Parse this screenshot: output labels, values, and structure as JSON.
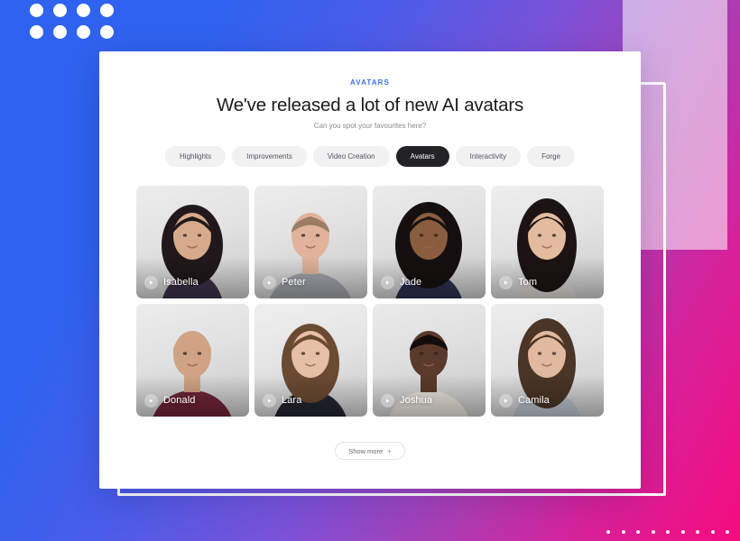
{
  "background": {
    "gradient_from": "#2f62ef",
    "gradient_mid": "#7b52d8",
    "gradient_to": "#f50c7e",
    "dot_color": "#ffffff",
    "dots_topleft_count": 8,
    "dots_bottomright_count": 10
  },
  "decor": {
    "glass_rect_label": "translucent-rectangle",
    "outline_frame_label": "white-outline-frame"
  },
  "panel": {
    "eyebrow": "AVATARS",
    "headline": "We've released a lot of new AI avatars",
    "subhead": "Can you spot your favourites here?",
    "accent_color": "#3d6fe6"
  },
  "tabs": [
    {
      "label": "Highlights",
      "active": false
    },
    {
      "label": "Improvements",
      "active": false
    },
    {
      "label": "Video Creation",
      "active": false
    },
    {
      "label": "Avatars",
      "active": true
    },
    {
      "label": "Interactivity",
      "active": false
    },
    {
      "label": "Forge",
      "active": false
    }
  ],
  "avatars": [
    {
      "name": "Isabella",
      "icon": "play-icon"
    },
    {
      "name": "Peter",
      "icon": "play-icon"
    },
    {
      "name": "Jade",
      "icon": "play-icon"
    },
    {
      "name": "Tom",
      "icon": "play-icon"
    },
    {
      "name": "Donald",
      "icon": "play-icon"
    },
    {
      "name": "Lara",
      "icon": "play-icon"
    },
    {
      "name": "Joshua",
      "icon": "play-icon"
    },
    {
      "name": "Camila",
      "icon": "play-icon"
    }
  ],
  "footer": {
    "show_more_label": "Show more",
    "show_more_plus": "+"
  }
}
